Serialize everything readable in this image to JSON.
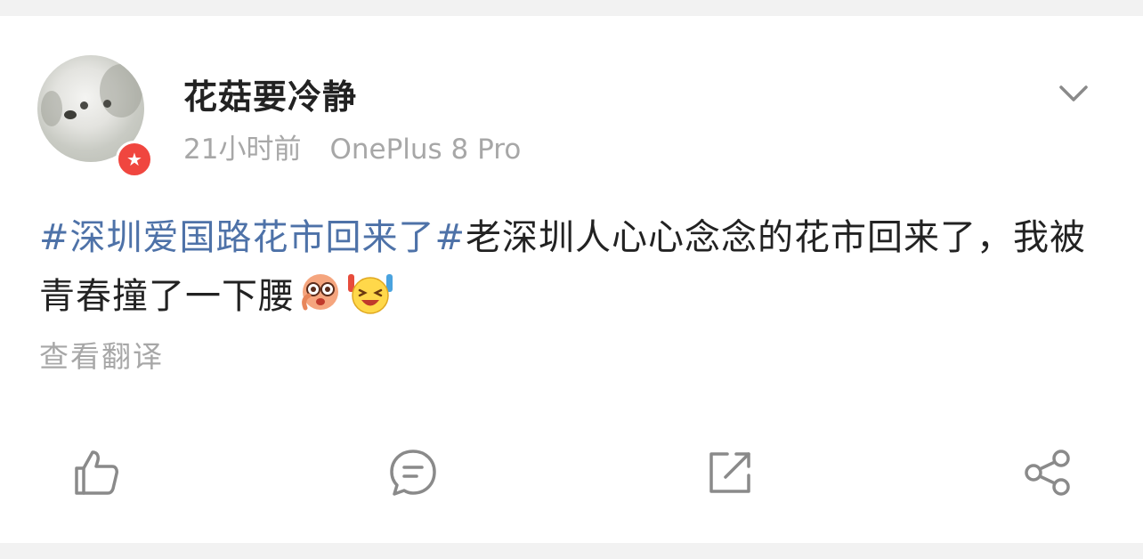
{
  "post": {
    "author": {
      "name": "花菇要冷静",
      "avatar_icon": "dog-avatar",
      "badge_icon": "star-badge-icon",
      "badge_glyph": "★",
      "badge_color": "#f0463f"
    },
    "timestamp": "21小时前",
    "device": "OnePlus 8 Pro",
    "text": {
      "hashtag": "#深圳爱国路花市回来了#",
      "body": "老深圳人心心念念的花市回来了，我被青春撞了一下腰"
    },
    "emojis": [
      "shocked-face-emoji",
      "cheering-laugh-emoji"
    ],
    "translate_label": "查看翻译"
  },
  "actions": {
    "like_icon": "thumbs-up-icon",
    "comment_icon": "comment-bubble-icon",
    "repost_icon": "repost-icon",
    "share_icon": "share-icon"
  },
  "colors": {
    "hashtag": "#4e72a8",
    "text": "#222222",
    "muted": "#a7a7a7",
    "background": "#f2f2f2",
    "card": "#ffffff"
  }
}
